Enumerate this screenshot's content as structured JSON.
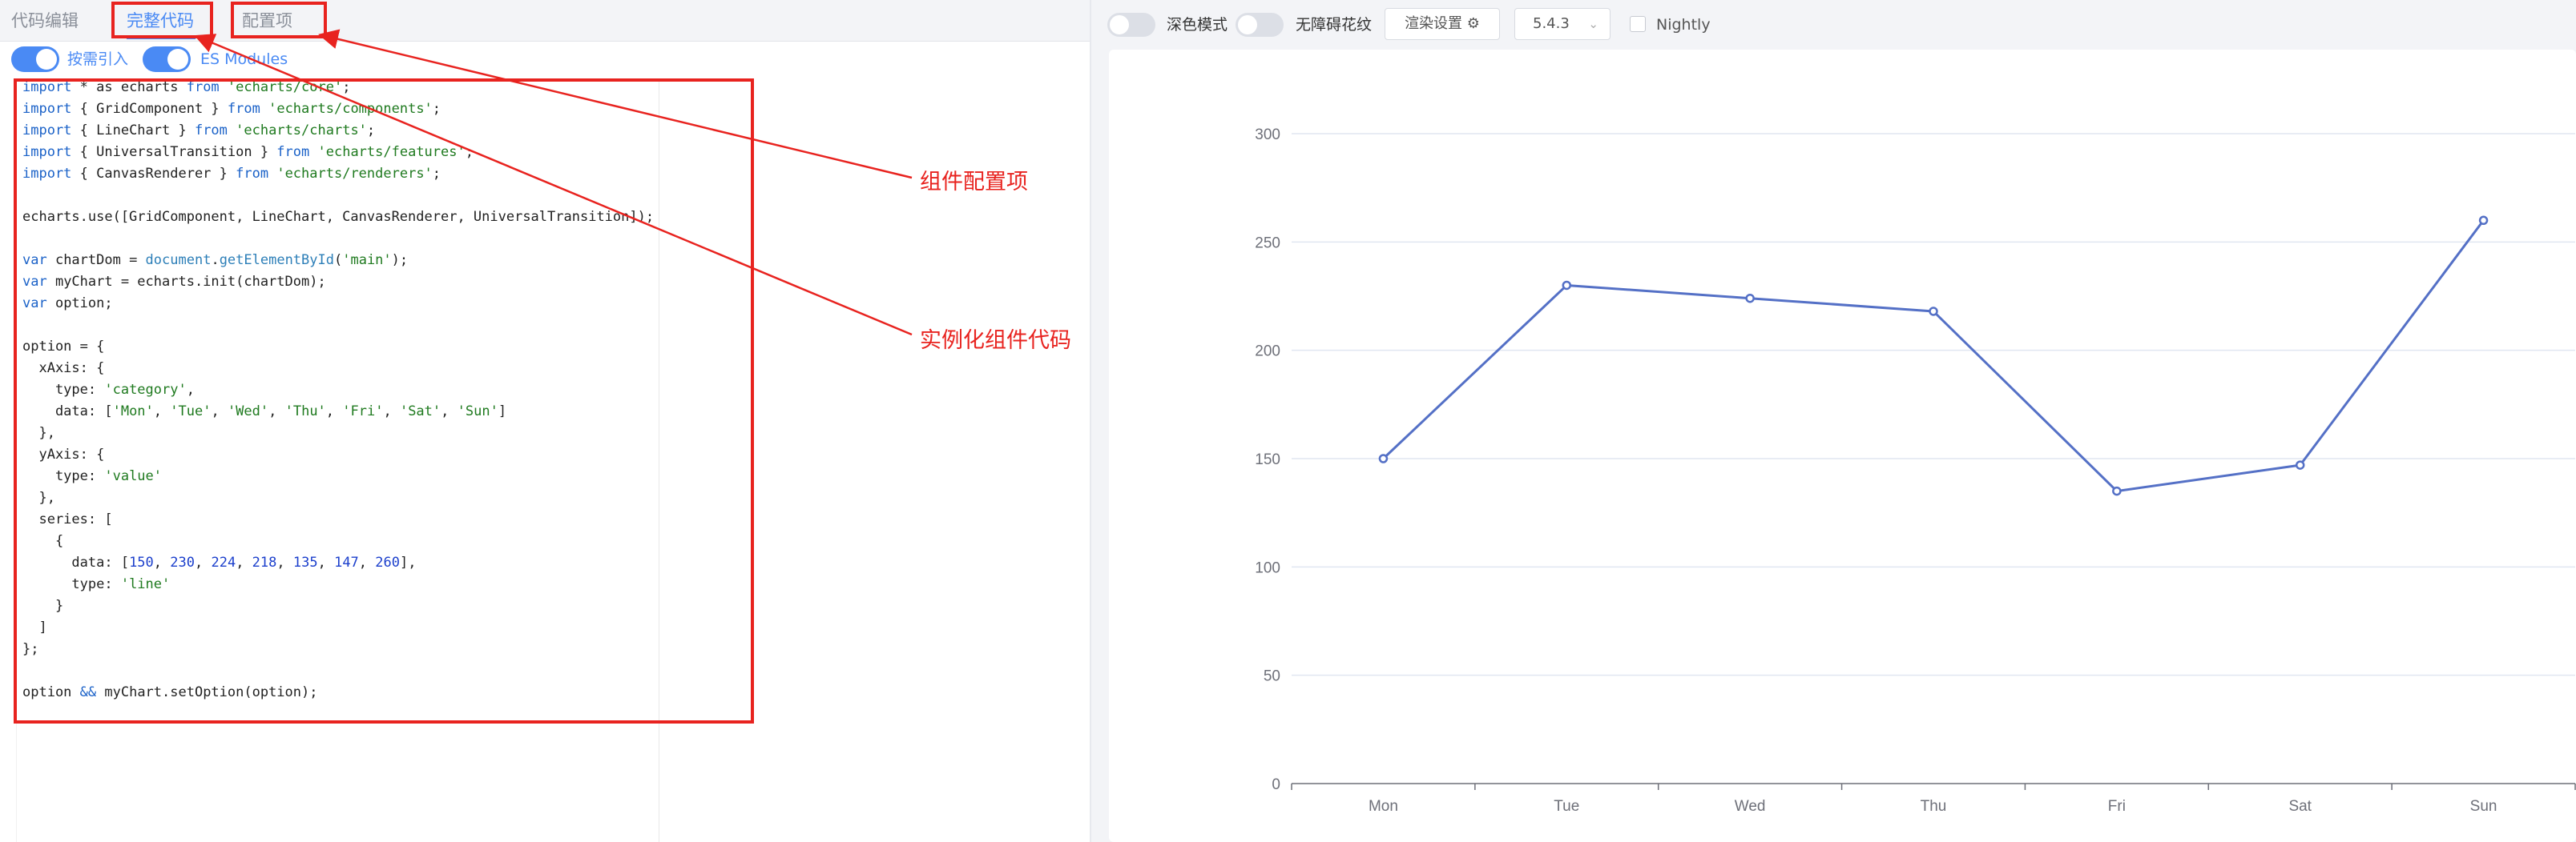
{
  "editor": {
    "tabs": [
      "代码编辑",
      "完整代码",
      "配置项"
    ],
    "options": {
      "on_demand": "按需引入",
      "es_modules": "ES Modules"
    },
    "code_lines": [
      [
        {
          "t": "import",
          "c": "kw"
        },
        {
          "t": " * as echarts "
        },
        {
          "t": "from",
          "c": "kw"
        },
        {
          "t": " "
        },
        {
          "t": "'echarts/core'",
          "c": "str"
        },
        {
          "t": ";"
        }
      ],
      [
        {
          "t": "import",
          "c": "kw"
        },
        {
          "t": " { GridComponent } "
        },
        {
          "t": "from",
          "c": "kw"
        },
        {
          "t": " "
        },
        {
          "t": "'echarts/components'",
          "c": "str"
        },
        {
          "t": ";"
        }
      ],
      [
        {
          "t": "import",
          "c": "kw"
        },
        {
          "t": " { LineChart } "
        },
        {
          "t": "from",
          "c": "kw"
        },
        {
          "t": " "
        },
        {
          "t": "'echarts/charts'",
          "c": "str"
        },
        {
          "t": ";"
        }
      ],
      [
        {
          "t": "import",
          "c": "kw"
        },
        {
          "t": " { UniversalTransition } "
        },
        {
          "t": "from",
          "c": "kw"
        },
        {
          "t": " "
        },
        {
          "t": "'echarts/features'",
          "c": "str"
        },
        {
          "t": ";"
        }
      ],
      [
        {
          "t": "import",
          "c": "kw"
        },
        {
          "t": " { CanvasRenderer } "
        },
        {
          "t": "from",
          "c": "kw"
        },
        {
          "t": " "
        },
        {
          "t": "'echarts/renderers'",
          "c": "str"
        },
        {
          "t": ";"
        }
      ],
      [],
      [
        {
          "t": "echarts.use([GridComponent, LineChart, CanvasRenderer, UniversalTransition]);"
        }
      ],
      [],
      [
        {
          "t": "var",
          "c": "kw"
        },
        {
          "t": " chartDom = "
        },
        {
          "t": "document",
          "c": "obj"
        },
        {
          "t": "."
        },
        {
          "t": "getElementById",
          "c": "obj"
        },
        {
          "t": "("
        },
        {
          "t": "'main'",
          "c": "str"
        },
        {
          "t": ");"
        }
      ],
      [
        {
          "t": "var",
          "c": "kw"
        },
        {
          "t": " myChart = echarts.init(chartDom);"
        }
      ],
      [
        {
          "t": "var",
          "c": "kw"
        },
        {
          "t": " option;"
        }
      ],
      [],
      [
        {
          "t": "option = {"
        }
      ],
      [
        {
          "t": "  xAxis: {"
        }
      ],
      [
        {
          "t": "    type: "
        },
        {
          "t": "'category'",
          "c": "str"
        },
        {
          "t": ","
        }
      ],
      [
        {
          "t": "    data: ["
        },
        {
          "t": "'Mon'",
          "c": "str"
        },
        {
          "t": ", "
        },
        {
          "t": "'Tue'",
          "c": "str"
        },
        {
          "t": ", "
        },
        {
          "t": "'Wed'",
          "c": "str"
        },
        {
          "t": ", "
        },
        {
          "t": "'Thu'",
          "c": "str"
        },
        {
          "t": ", "
        },
        {
          "t": "'Fri'",
          "c": "str"
        },
        {
          "t": ", "
        },
        {
          "t": "'Sat'",
          "c": "str"
        },
        {
          "t": ", "
        },
        {
          "t": "'Sun'",
          "c": "str"
        },
        {
          "t": "]"
        }
      ],
      [
        {
          "t": "  },"
        }
      ],
      [
        {
          "t": "  yAxis: {"
        }
      ],
      [
        {
          "t": "    type: "
        },
        {
          "t": "'value'",
          "c": "str"
        }
      ],
      [
        {
          "t": "  },"
        }
      ],
      [
        {
          "t": "  series: ["
        }
      ],
      [
        {
          "t": "    {"
        }
      ],
      [
        {
          "t": "      data: ["
        },
        {
          "t": "150",
          "c": "num"
        },
        {
          "t": ", "
        },
        {
          "t": "230",
          "c": "num"
        },
        {
          "t": ", "
        },
        {
          "t": "224",
          "c": "num"
        },
        {
          "t": ", "
        },
        {
          "t": "218",
          "c": "num"
        },
        {
          "t": ", "
        },
        {
          "t": "135",
          "c": "num"
        },
        {
          "t": ", "
        },
        {
          "t": "147",
          "c": "num"
        },
        {
          "t": ", "
        },
        {
          "t": "260",
          "c": "num"
        },
        {
          "t": "],"
        }
      ],
      [
        {
          "t": "      type: "
        },
        {
          "t": "'line'",
          "c": "str"
        }
      ],
      [
        {
          "t": "    }"
        }
      ],
      [
        {
          "t": "  ]"
        }
      ],
      [
        {
          "t": "};"
        }
      ],
      [],
      [
        {
          "t": "option "
        },
        {
          "t": "&&",
          "c": "kw"
        },
        {
          "t": " myChart.setOption(option);"
        }
      ]
    ]
  },
  "annotations": {
    "component_config": "组件配置项",
    "instantiate_code": "实例化组件代码"
  },
  "preview_toolbar": {
    "dark_mode": "深色模式",
    "a11y_pattern": "无障碍花纹",
    "render_settings": "渲染设置 ⚙",
    "version": "5.4.3",
    "nightly": "Nightly"
  },
  "colors": {
    "accent": "#4a8af4",
    "annotation_red": "#e8231f",
    "series_line": "#5470c6"
  },
  "chart_data": {
    "type": "line",
    "categories": [
      "Mon",
      "Tue",
      "Wed",
      "Thu",
      "Fri",
      "Sat",
      "Sun"
    ],
    "series": [
      {
        "values": [
          150,
          230,
          224,
          218,
          135,
          147,
          260
        ]
      }
    ],
    "yticks": [
      0,
      50,
      100,
      150,
      200,
      250,
      300
    ],
    "ylim": [
      0,
      300
    ],
    "grid": true,
    "title": "",
    "xlabel": "",
    "ylabel": ""
  }
}
